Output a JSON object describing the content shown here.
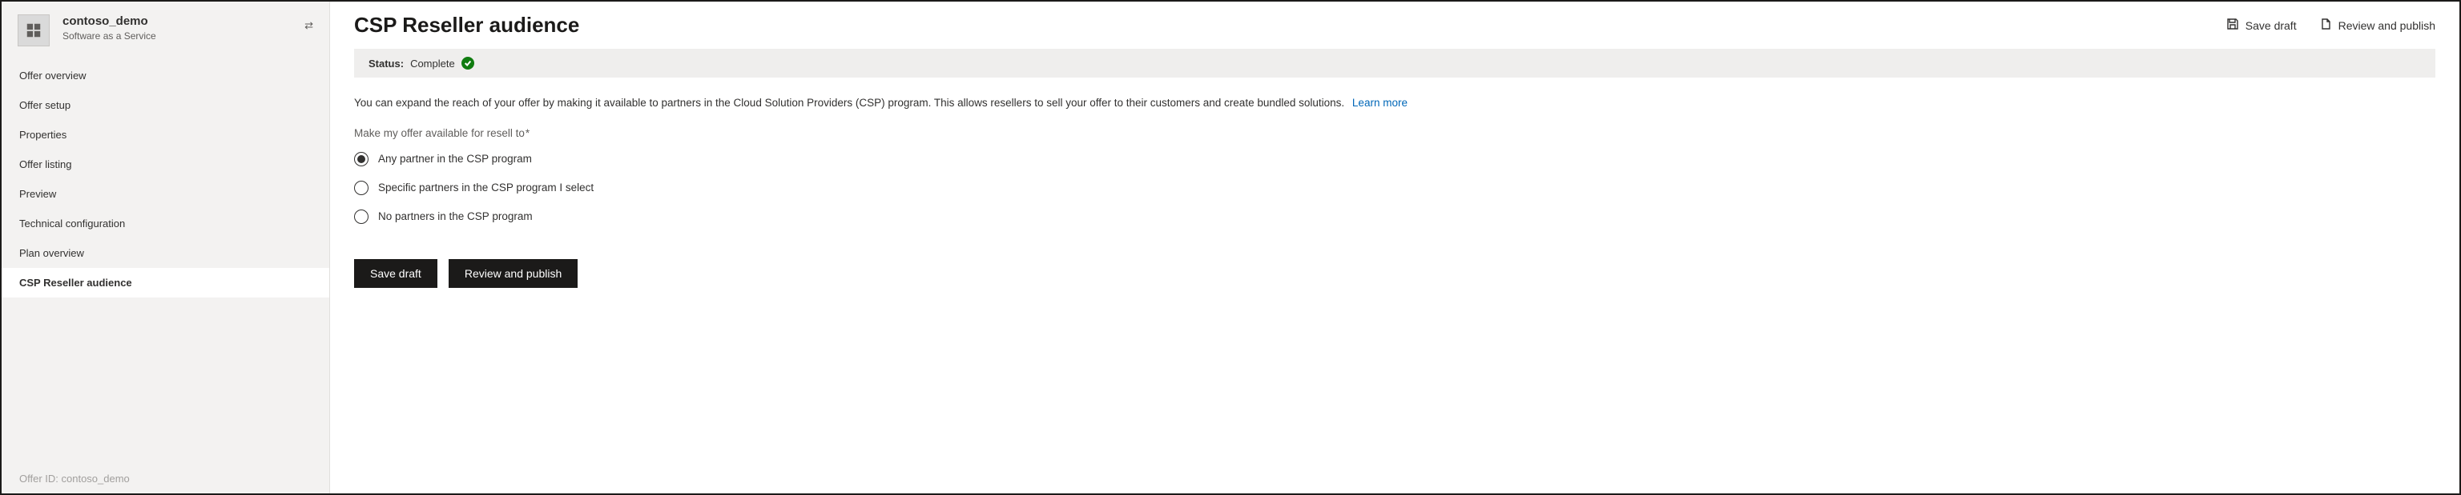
{
  "sidebar": {
    "offer_title": "contoso_demo",
    "offer_subtitle": "Software as a Service",
    "nav": [
      {
        "label": "Offer overview"
      },
      {
        "label": "Offer setup"
      },
      {
        "label": "Properties"
      },
      {
        "label": "Offer listing"
      },
      {
        "label": "Preview"
      },
      {
        "label": "Technical configuration"
      },
      {
        "label": "Plan overview"
      },
      {
        "label": "CSP Reseller audience",
        "active": true
      }
    ],
    "footer": "Offer ID: contoso_demo"
  },
  "header": {
    "title": "CSP Reseller audience",
    "save_draft": "Save draft",
    "review_publish": "Review and publish"
  },
  "status": {
    "label": "Status:",
    "value": "Complete"
  },
  "description": "You can expand the reach of your offer by making it available to partners in the Cloud Solution Providers (CSP) program. This allows resellers to sell your offer to their customers and create bundled solutions.",
  "learn_more": "Learn more",
  "field_label": "Make my offer available for resell to",
  "required_mark": "*",
  "options": [
    {
      "label": "Any partner in the CSP program",
      "selected": true
    },
    {
      "label": "Specific partners in the CSP program I select",
      "selected": false
    },
    {
      "label": "No partners in the CSP program",
      "selected": false
    }
  ],
  "buttons": {
    "save_draft": "Save draft",
    "review_publish": "Review and publish"
  }
}
